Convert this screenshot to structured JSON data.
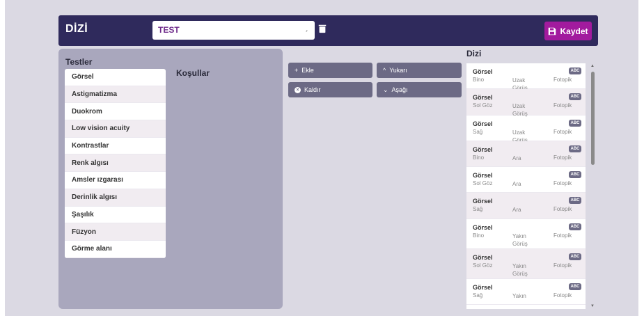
{
  "header": {
    "title": "DİZİ",
    "select_value": "TEST",
    "save_label": "Kaydet"
  },
  "left": {
    "tests_label": "Testler",
    "conditions_label": "Koşullar",
    "tests": [
      "Görsel",
      "Astigmatizma",
      "Duokrom",
      "Low vision acuity",
      "Kontrastlar",
      "Renk algısı",
      "Amsler ızgarası",
      "Derinlik algısı",
      "Şaşılık",
      "Füzyon",
      "Görme alanı"
    ]
  },
  "actions": {
    "add": "Ekle",
    "remove": "Kaldır",
    "up": "Yukarı",
    "down": "Aşağı"
  },
  "dizi": {
    "label": "Dizi",
    "rows": [
      {
        "title": "Görsel",
        "eye": "Bino",
        "distance": "Uzak Görüş",
        "mode": "Fotopik",
        "badge": "ABC"
      },
      {
        "title": "Görsel",
        "eye": "Sol Göz",
        "distance": "Uzak Görüş",
        "mode": "Fotopik",
        "badge": "ABC"
      },
      {
        "title": "Görsel",
        "eye": "Sağ",
        "distance": "Uzak Görüş",
        "mode": "Fotopik",
        "badge": "ABC"
      },
      {
        "title": "Görsel",
        "eye": "Bino",
        "distance": "Ara",
        "mode": "Fotopik",
        "badge": "ABC"
      },
      {
        "title": "Görsel",
        "eye": "Sol Göz",
        "distance": "Ara",
        "mode": "Fotopik",
        "badge": "ABC"
      },
      {
        "title": "Görsel",
        "eye": "Sağ",
        "distance": "Ara",
        "mode": "Fotopik",
        "badge": "ABC"
      },
      {
        "title": "Görsel",
        "eye": "Bino",
        "distance": "Yakın Görüş",
        "mode": "Fotopik",
        "badge": "ABC"
      },
      {
        "title": "Görsel",
        "eye": "Sol Göz",
        "distance": "Yakın Görüş",
        "mode": "Fotopik",
        "badge": "ABC"
      },
      {
        "title": "Görsel",
        "eye": "Sağ",
        "distance": "Yakın",
        "mode": "Fotopik",
        "badge": "ABC"
      }
    ]
  },
  "colors": {
    "header_bg": "#2f2a5c",
    "save_bg": "#a21b9e",
    "panel_bg": "#a9a7bd",
    "button_bg": "#6c6a85",
    "page_bg": "#dbd9e3"
  }
}
